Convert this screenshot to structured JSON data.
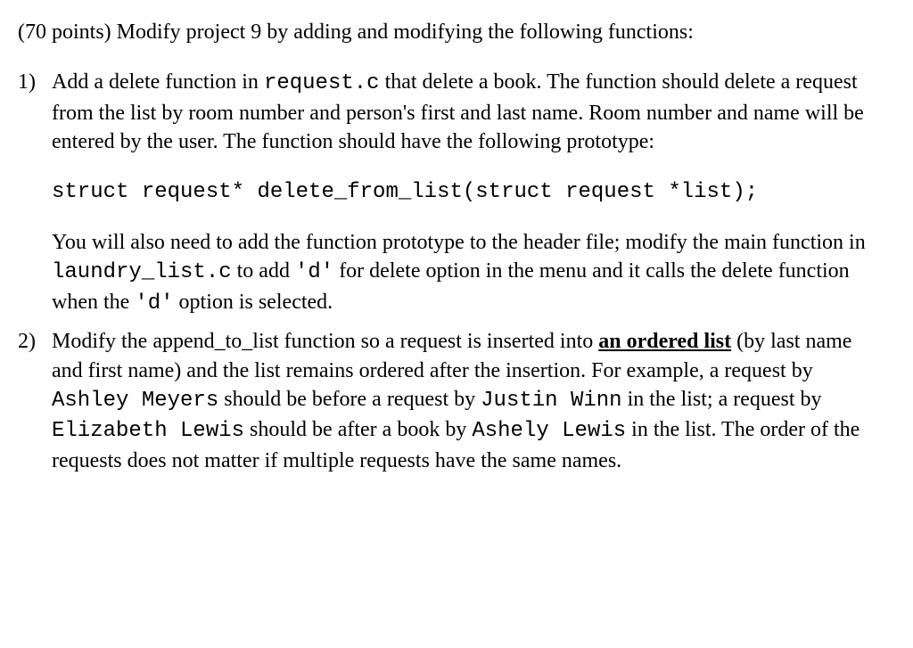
{
  "intro": "(70 points) Modify project 9 by adding and modifying the following functions:",
  "item1": {
    "num": "1)",
    "p1a": "Add a delete function in ",
    "p1b": "request.c",
    "p1c": " that delete a book. The function should delete a request from the list by room number and person's first and last name. Room number and name will be entered by the user. The function should have the following prototype:",
    "code": "struct request* delete_from_list(struct request *list);",
    "p2a": "You will also need to add the function prototype to the header file; modify the main function in ",
    "p2b": "laundry_list.c",
    "p2c": " to add ",
    "p2d": "'d'",
    "p2e": "  for delete option in the menu and it calls the delete function when the  ",
    "p2f": "'d'",
    "p2g": "   option is selected."
  },
  "item2": {
    "num": "2)",
    "a": "Modify the append_to_list function so a request is inserted into ",
    "b": "an ordered list",
    "c": " (by last name and first name) and the list remains ordered after the insertion. For example, a request by ",
    "d": "Ashley Meyers",
    "e": "  should be before a request by ",
    "f": "Justin Winn",
    "g": "  in the list; a request by ",
    "h": "Elizabeth Lewis",
    "i": " should be after a book by ",
    "j": "Ashely Lewis",
    "k": "  in the list. The order of the requests does not matter if multiple requests have the same names."
  }
}
